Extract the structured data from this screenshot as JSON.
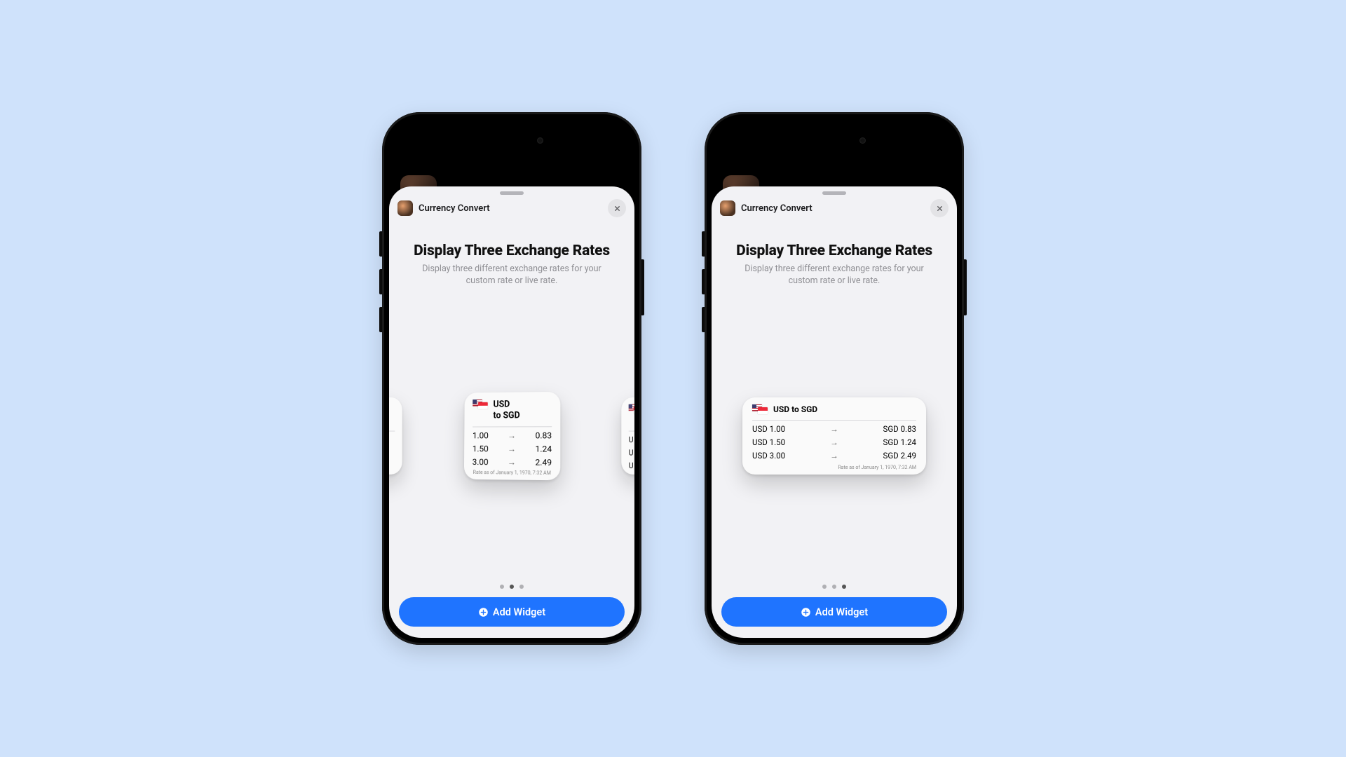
{
  "app": {
    "name": "Currency Convert"
  },
  "sheet": {
    "title": "Display Three Exchange Rates",
    "subtitle": "Display three different exchange rates for your custom rate or live rate.",
    "addWidgetLabel": "Add Widget"
  },
  "pager": {
    "left": {
      "count": 3,
      "active": 1
    },
    "right": {
      "count": 3,
      "active": 2
    }
  },
  "widgetSmall": {
    "titleLine1": "USD",
    "titleLine2": "to SGD",
    "rows": [
      {
        "from": "1.00",
        "to": "0.83"
      },
      {
        "from": "1.50",
        "to": "1.24"
      },
      {
        "from": "3.00",
        "to": "2.49"
      }
    ],
    "footer": "Rate as of January 1, 1970, 7:32 AM"
  },
  "widgetMed": {
    "title": "USD to SGD",
    "rows": [
      {
        "from": "USD 1.00",
        "to": "SGD 0.83"
      },
      {
        "from": "USD 1.50",
        "to": "SGD 1.24"
      },
      {
        "from": "USD 3.00",
        "to": "SGD 2.49"
      }
    ],
    "footer": "Rate as of January 1, 1970, 7:32 AM"
  },
  "glyphs": {
    "arrow": "→"
  }
}
